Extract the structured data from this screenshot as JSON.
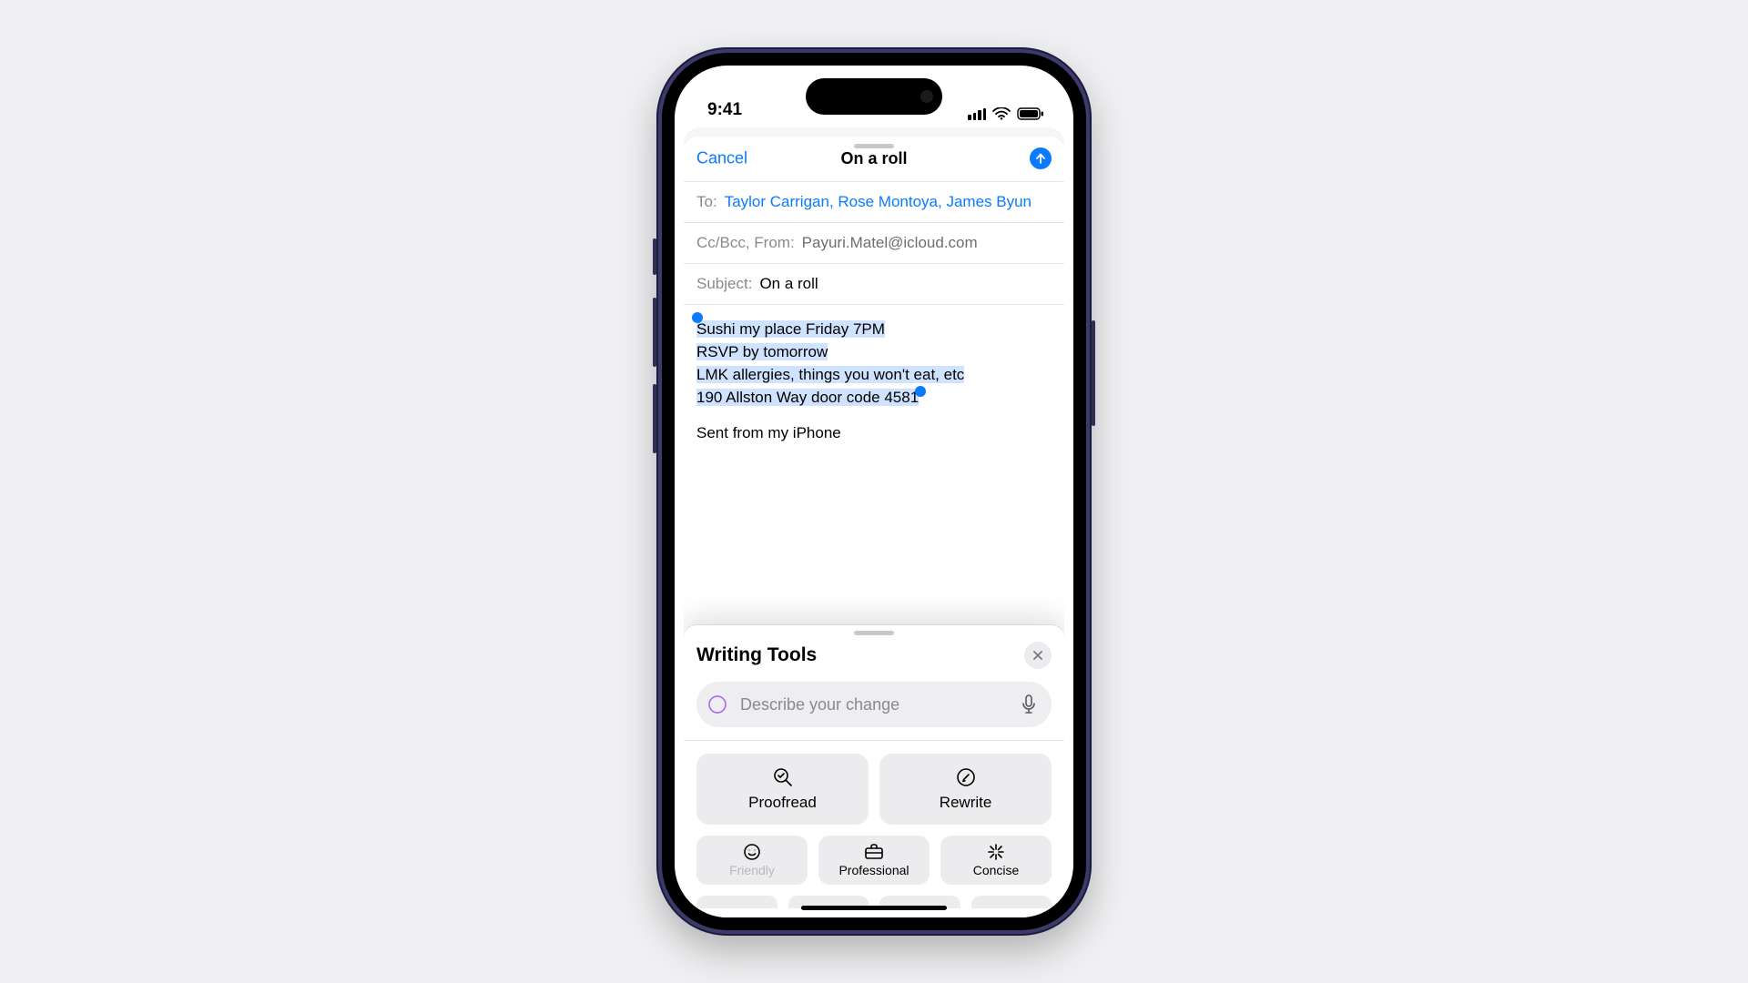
{
  "status": {
    "time": "9:41"
  },
  "compose": {
    "cancel": "Cancel",
    "title": "On a roll",
    "to_label": "To:",
    "recipients": "Taylor Carrigan, Rose Montoya, James Byun",
    "ccbcc_label": "Cc/Bcc, From:",
    "from_address": "Payuri.Matel@icloud.com",
    "subject_label": "Subject:",
    "subject_value": "On a roll",
    "body_selected_lines": [
      "Sushi my place Friday 7PM",
      "RSVP by tomorrow",
      "LMK allergies, things you won't eat, etc",
      "190 Allston Way door code 4581"
    ],
    "signature": "Sent from my iPhone"
  },
  "tools": {
    "title": "Writing Tools",
    "prompt_placeholder": "Describe your change",
    "buttons": {
      "proofread": "Proofread",
      "rewrite": "Rewrite",
      "friendly": "Friendly",
      "professional": "Professional",
      "concise": "Concise"
    }
  }
}
